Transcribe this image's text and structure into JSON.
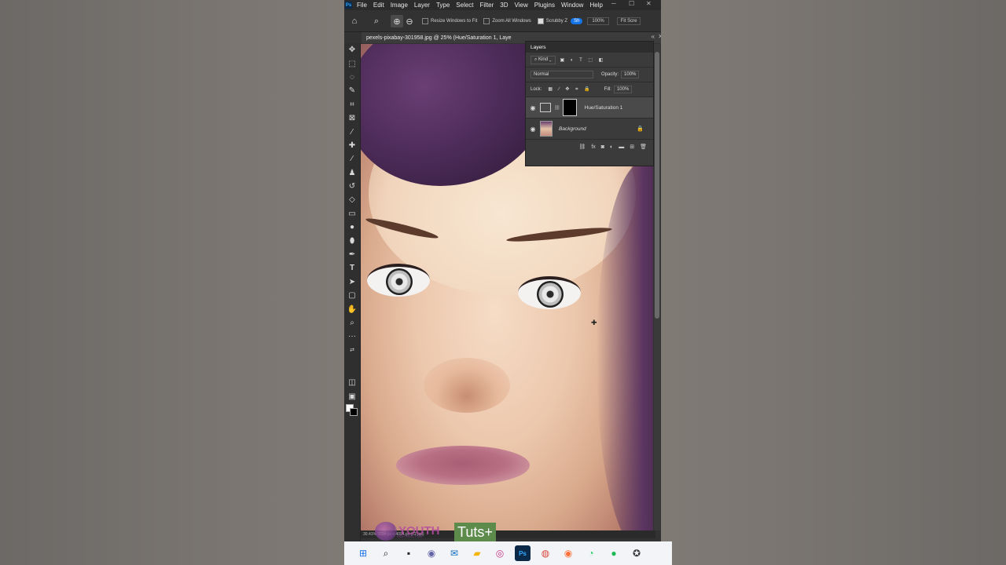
{
  "photoshop": {
    "menu": [
      "File",
      "Edit",
      "Image",
      "Layer",
      "Type",
      "Select",
      "Filter",
      "3D",
      "View",
      "Plugins",
      "Window",
      "Help"
    ],
    "logo": "Ps",
    "options": {
      "resize_windows": "Resize Windows to Fit",
      "zoom_all": "Zoom All Windows",
      "scrubby": "Scrubby Z",
      "sh_badge": "Sh",
      "percent": "100%",
      "fit_screen": "Fit Scre"
    },
    "document_tab": "pexels-pixabay-301958.jpg @ 25% (Hue/Saturation 1, Laye",
    "status": "30.41%   5094 px x 4094 px (72 ppi)",
    "layers_panel": {
      "title": "Layers",
      "filter_label": "Kind",
      "blend_mode": "Normal",
      "opacity_label": "Opacity:",
      "opacity_value": "100%",
      "lock_label": "Lock:",
      "fill_label": "Fill:",
      "fill_value": "100%",
      "layers": [
        {
          "name": "Hue/Saturation 1",
          "type": "adjustment",
          "selected": true
        },
        {
          "name": "Background",
          "type": "image",
          "locked": true
        }
      ]
    }
  },
  "watermarks": {
    "youth": "YOUTH",
    "youth_sub": "INSTRUCTOR",
    "tuts": "Tuts+"
  },
  "colors": {
    "ps_dark": "#323232",
    "accent_blue": "#1473e6",
    "tuts_green": "#5d8b4b"
  }
}
